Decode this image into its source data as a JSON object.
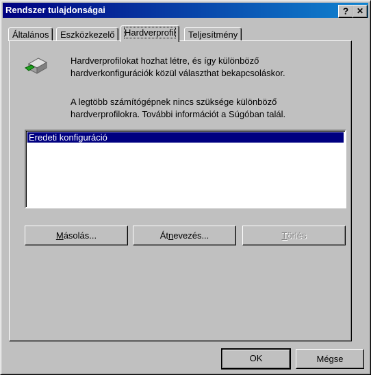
{
  "window": {
    "title": "Rendszer tulajdonságai",
    "help_label": "?",
    "close_label": "✕"
  },
  "tabs": [
    {
      "label": "Általános"
    },
    {
      "label": "Eszközkezelő"
    },
    {
      "label": "Hardverprofil",
      "active": true
    },
    {
      "label": "Teljesítmény"
    }
  ],
  "content": {
    "icon": "hardware-profile-icon",
    "para1": [
      "Hardverprofilokat hozhat létre, és így különböző",
      "hardverkonfigurációk közül választhat bekapcsoláskor."
    ],
    "para2": [
      "A legtöbb számítógépnek nincs szüksége különböző",
      "hardverprofilokra. További információt a Súgóban talál."
    ],
    "profiles": [
      {
        "label": "Eredeti konfiguráció",
        "selected": true
      }
    ],
    "buttons": [
      {
        "pre": "",
        "key": "M",
        "post": "ásolás...",
        "enabled": true
      },
      {
        "pre": "Át",
        "key": "n",
        "post": "evezés...",
        "enabled": true
      },
      {
        "pre": "",
        "key": "T",
        "post": "örlés",
        "enabled": false
      }
    ]
  },
  "footer": {
    "ok_label": "OK",
    "cancel_label": "Mégse"
  }
}
